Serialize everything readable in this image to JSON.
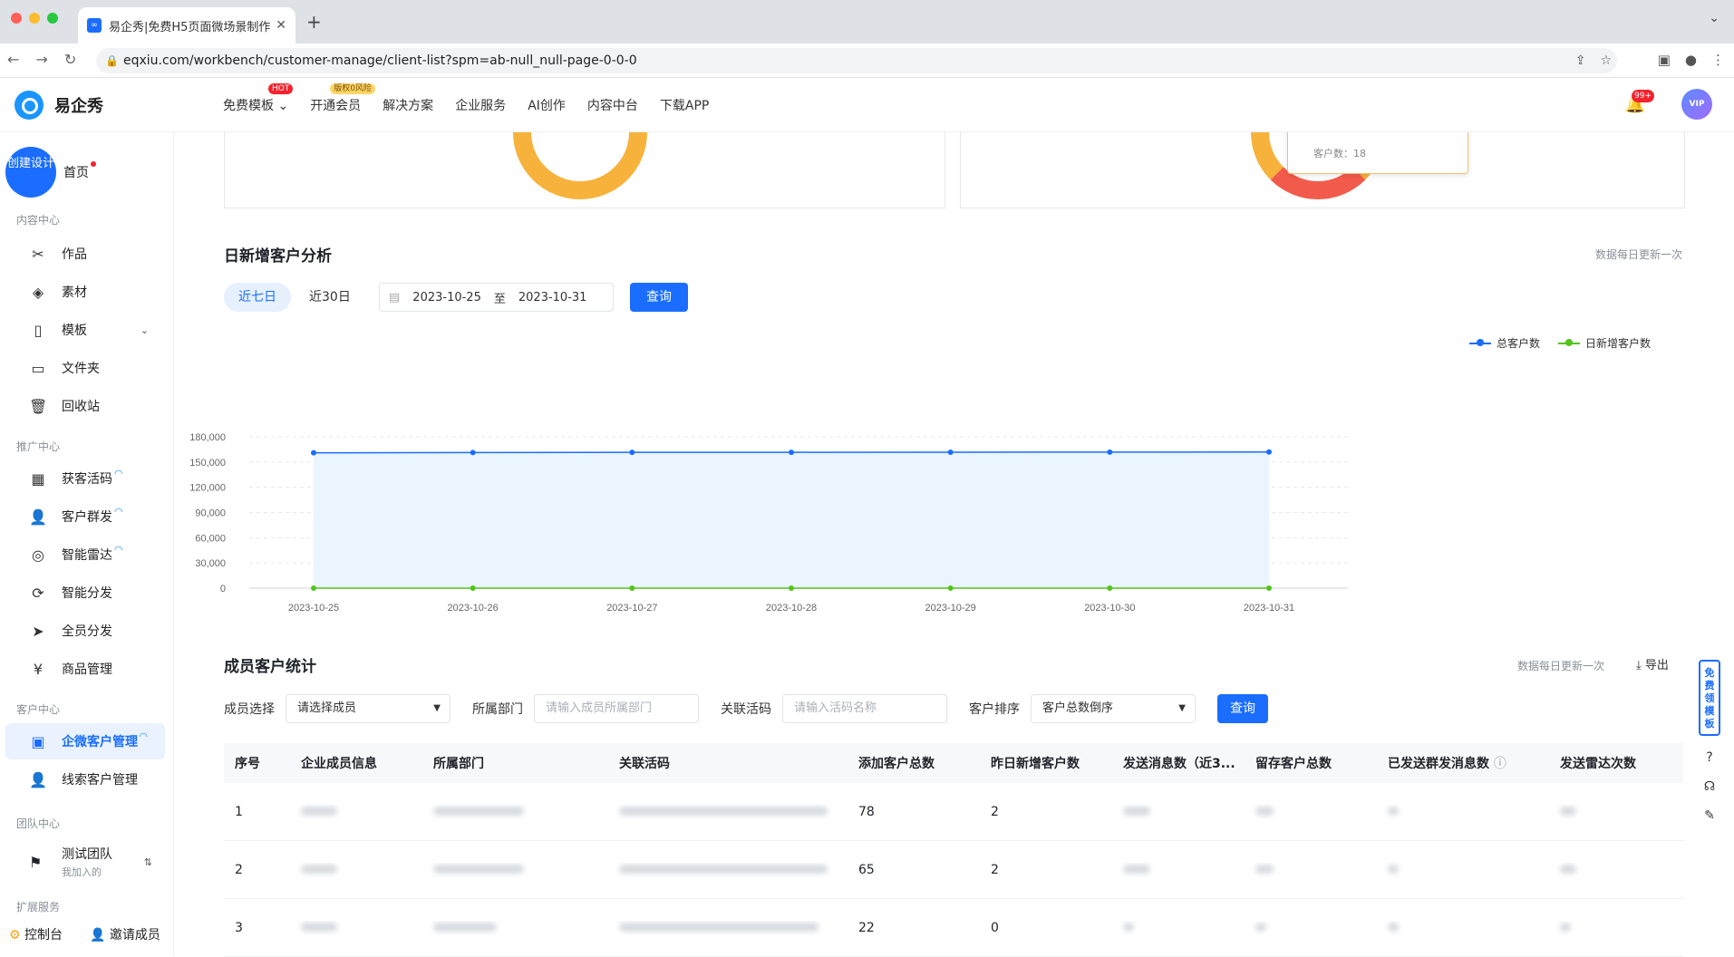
{
  "browser": {
    "tab_title": "易企秀|免费H5页面微场景制作",
    "url": "eqxiu.com/workbench/customer-manage/client-list?spm=ab-null_null-page-0-0-0"
  },
  "header": {
    "logo": "易企秀",
    "nav": [
      "免费模板",
      "开通会员",
      "解决方案",
      "企业服务",
      "AI创作",
      "内容中台",
      "下载APP"
    ],
    "hot_badge": "HOT",
    "vip_badge": "版权0风险",
    "notice_count": "99+",
    "avatar_label": "VIP"
  },
  "sidebar": {
    "create_label": "创建设计",
    "home": "首页",
    "sections": {
      "content": "内容中心",
      "promo": "推广中心",
      "customer": "客户中心",
      "team": "团队中心",
      "ext": "扩展服务"
    },
    "content_items": [
      "作品",
      "素材",
      "模板",
      "文件夹",
      "回收站"
    ],
    "promo_items": [
      "获客活码",
      "客户群发",
      "智能雷达",
      "智能分发",
      "全员分发",
      "商品管理"
    ],
    "customer_items": [
      "企微客户管理",
      "线索客户管理"
    ],
    "team_name": "测试团队",
    "team_sub": "我加入的",
    "console": "控制台",
    "invite": "邀请成员"
  },
  "tooltip": {
    "label": "客户数：18"
  },
  "analysis": {
    "title": "日新增客户分析",
    "note": "数据每日更新一次",
    "range_tabs": [
      "近七日",
      "近30日"
    ],
    "start_date": "2023-10-25",
    "to": "至",
    "end_date": "2023-10-31",
    "query": "查询"
  },
  "chart_data": {
    "type": "line",
    "title": "",
    "x": [
      "2023-10-25",
      "2023-10-26",
      "2023-10-27",
      "2023-10-28",
      "2023-10-29",
      "2023-10-30",
      "2023-10-31"
    ],
    "series": [
      {
        "name": "总客户数",
        "color": "#1a6dff",
        "values": [
          161000,
          161300,
          161500,
          161600,
          161700,
          161800,
          161900
        ]
      },
      {
        "name": "日新增客户数",
        "color": "#52c41a",
        "values": [
          0,
          0,
          0,
          0,
          0,
          0,
          0
        ]
      }
    ],
    "yticks": [
      "0",
      "30,000",
      "60,000",
      "90,000",
      "120,000",
      "150,000",
      "180,000"
    ],
    "ylim": [
      0,
      180000
    ],
    "grid": true,
    "legend": "top-right"
  },
  "members": {
    "title": "成员客户统计",
    "note": "数据每日更新一次",
    "export": "导出",
    "filters": {
      "member_label": "成员选择",
      "member_value": "请选择成员",
      "dept_label": "所属部门",
      "dept_placeholder": "请输入成员所属部门",
      "code_label": "关联活码",
      "code_placeholder": "请输入活码名称",
      "sort_label": "客户排序",
      "sort_value": "客户总数倒序",
      "query": "查询"
    },
    "columns": [
      "序号",
      "企业成员信息",
      "所属部门",
      "关联活码",
      "添加客户总数",
      "昨日新增客户数",
      "发送消息数（近3...",
      "留存客户总数",
      "已发送群发消息数",
      "发送雷达次数"
    ],
    "rows": [
      {
        "no": "1",
        "total": "78",
        "yesterday": "2"
      },
      {
        "no": "2",
        "total": "65",
        "yesterday": "2"
      },
      {
        "no": "3",
        "total": "22",
        "yesterday": "0"
      }
    ]
  },
  "side_tools": {
    "free_template": "免费领模板"
  }
}
